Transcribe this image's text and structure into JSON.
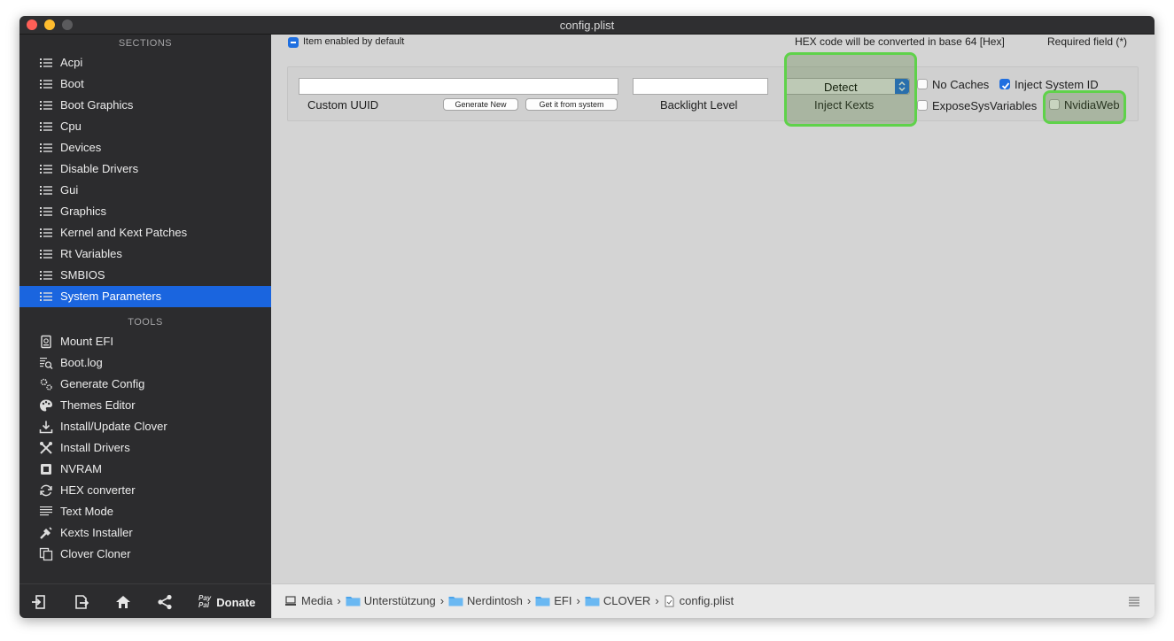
{
  "window": {
    "title": "config.plist"
  },
  "sidebar": {
    "sections_header": "SECTIONS",
    "sections": [
      {
        "label": "Acpi",
        "icon": "list-icon"
      },
      {
        "label": "Boot",
        "icon": "list-icon"
      },
      {
        "label": "Boot Graphics",
        "icon": "list-icon"
      },
      {
        "label": "Cpu",
        "icon": "list-icon"
      },
      {
        "label": "Devices",
        "icon": "list-icon"
      },
      {
        "label": "Disable Drivers",
        "icon": "list-icon"
      },
      {
        "label": "Gui",
        "icon": "list-icon"
      },
      {
        "label": "Graphics",
        "icon": "list-icon"
      },
      {
        "label": "Kernel and Kext Patches",
        "icon": "list-icon"
      },
      {
        "label": "Rt Variables",
        "icon": "list-icon"
      },
      {
        "label": "SMBIOS",
        "icon": "list-icon"
      },
      {
        "label": "System Parameters",
        "icon": "list-icon",
        "selected": true
      }
    ],
    "tools_header": "TOOLS",
    "tools": [
      {
        "label": "Mount EFI",
        "icon": "disk-icon"
      },
      {
        "label": "Boot.log",
        "icon": "log-icon"
      },
      {
        "label": "Generate Config",
        "icon": "gears-icon"
      },
      {
        "label": "Themes Editor",
        "icon": "palette-icon"
      },
      {
        "label": "Install/Update Clover",
        "icon": "download-icon"
      },
      {
        "label": "Install Drivers",
        "icon": "tools-icon"
      },
      {
        "label": "NVRAM",
        "icon": "chip-icon"
      },
      {
        "label": "HEX converter",
        "icon": "refresh-icon"
      },
      {
        "label": "Text Mode",
        "icon": "text-lines-icon"
      },
      {
        "label": "Kexts Installer",
        "icon": "wrench-icon"
      },
      {
        "label": "Clover Cloner",
        "icon": "copy-icon"
      }
    ],
    "bottom": {
      "donate_label": "Donate",
      "paypal_top": "Pay",
      "paypal_bottom": "Pal"
    }
  },
  "topbar": {
    "item_enabled": "Item enabled by default",
    "hex_note": "HEX code will be converted in base 64 [Hex]",
    "required_note": "Required field (*)"
  },
  "panel": {
    "custom_uuid_label": "Custom UUID",
    "custom_uuid_value": "",
    "generate_new": "Generate New",
    "get_from_system": "Get it from system",
    "backlight_label": "Backlight Level",
    "backlight_value": "",
    "inject_kexts_label": "Inject Kexts",
    "inject_kexts_value": "Detect",
    "no_caches": "No Caches",
    "inject_system_id": "Inject System ID",
    "expose_sys_variables": "ExposeSysVariables",
    "nvidia_web": "NvidiaWeb"
  },
  "pathbar": {
    "items": [
      "Media",
      "Unterstützung",
      "Nerdintosh",
      "EFI",
      "CLOVER",
      "config.plist"
    ],
    "separator": "›"
  },
  "colors": {
    "accent": "#1f6fe0",
    "selection": "#1a65df",
    "highlight": "#5fd24a"
  }
}
